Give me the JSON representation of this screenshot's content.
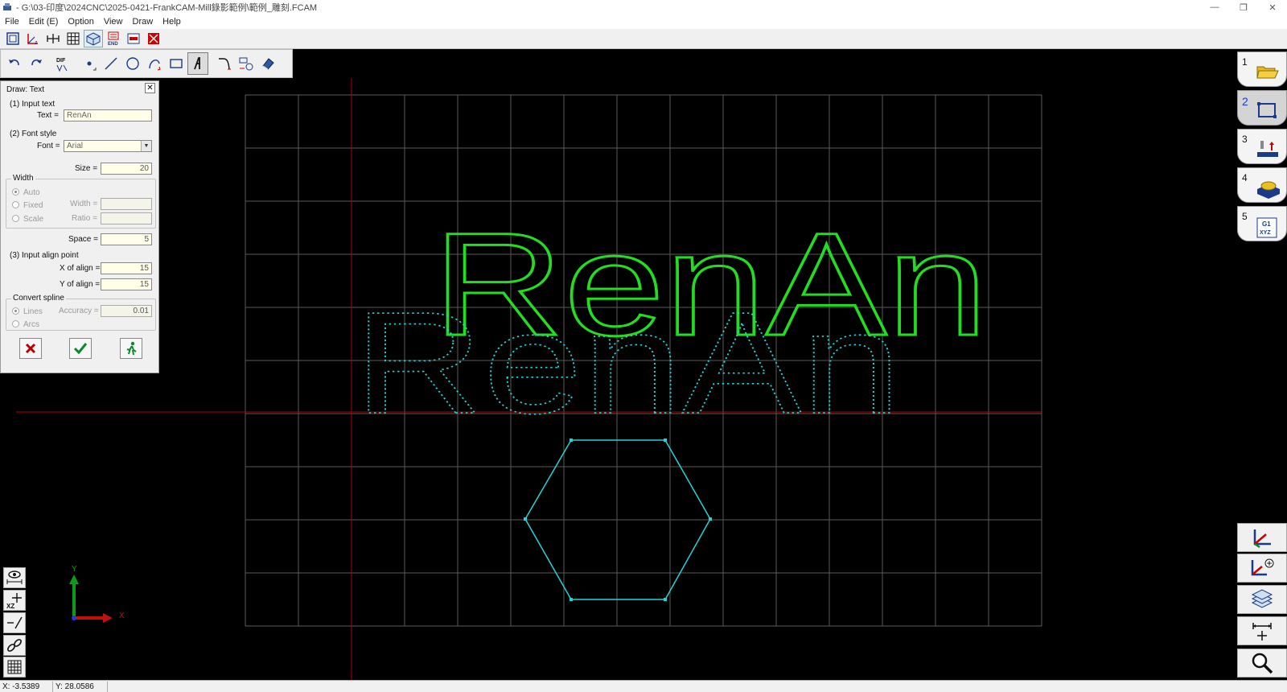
{
  "window": {
    "title": "- G:\\03-印度\\2024CNC\\2025-0421-FrankCAM-Mill錄影範例\\範例_雕刻.FCAM",
    "minimize": "—",
    "maximize": "❐",
    "close": "✕"
  },
  "menu": [
    {
      "label": "File"
    },
    {
      "label": "Edit (E)"
    },
    {
      "label": "Option"
    },
    {
      "label": "View"
    },
    {
      "label": "Draw"
    },
    {
      "label": "Help"
    }
  ],
  "toolbar2": {
    "dif_label": "DIF"
  },
  "dialog": {
    "title": "Draw: Text",
    "close": "✕",
    "section1": "(1) Input text",
    "text_label": "Text =",
    "text_value": "RenAn",
    "section2": "(2) Font style",
    "font_label": "Font =",
    "font_value": "Arial",
    "size_label": "Size =",
    "size_value": "20",
    "width_group": "Width",
    "width_auto": "Auto",
    "width_fixed": "Fixed",
    "width_scale": "Scale",
    "width_label": "Width =",
    "ratio_label": "Ratio =",
    "space_label": "Space =",
    "space_value": "5",
    "section3": "(3) Input align point",
    "xalign_label": "X of align =",
    "xalign_value": "15",
    "yalign_label": "Y of align =",
    "yalign_value": "15",
    "spline_group": "Convert spline",
    "spline_lines": "Lines",
    "spline_arcs": "Arcs",
    "accuracy_label": "Accuracy =",
    "accuracy_value": "0.01"
  },
  "canvas": {
    "background": "#000000",
    "grid_color": "#5a5a5a",
    "axis_color": "#b40000",
    "preview_color": "#22dd22",
    "geometry_color": "#22d4d4",
    "preview_text": "RenAn",
    "geometry_text": "RenAn",
    "axis_y_label": "Y",
    "axis_x_label": "X"
  },
  "side_tabs": [
    {
      "num": "1",
      "icon": "open-folder-icon"
    },
    {
      "num": "2",
      "icon": "draw-rectangle-icon"
    },
    {
      "num": "3",
      "icon": "tool-path-icon"
    },
    {
      "num": "4",
      "icon": "material-stock-icon"
    },
    {
      "num": "5",
      "icon": "gcode-icon"
    }
  ],
  "left_tools": {
    "xz_label": "XZ"
  },
  "gcode_icon": {
    "line1": "G1",
    "line2": "XYZ"
  },
  "status": {
    "x": "X: -3.5389",
    "y": "Y: 28.0586"
  }
}
